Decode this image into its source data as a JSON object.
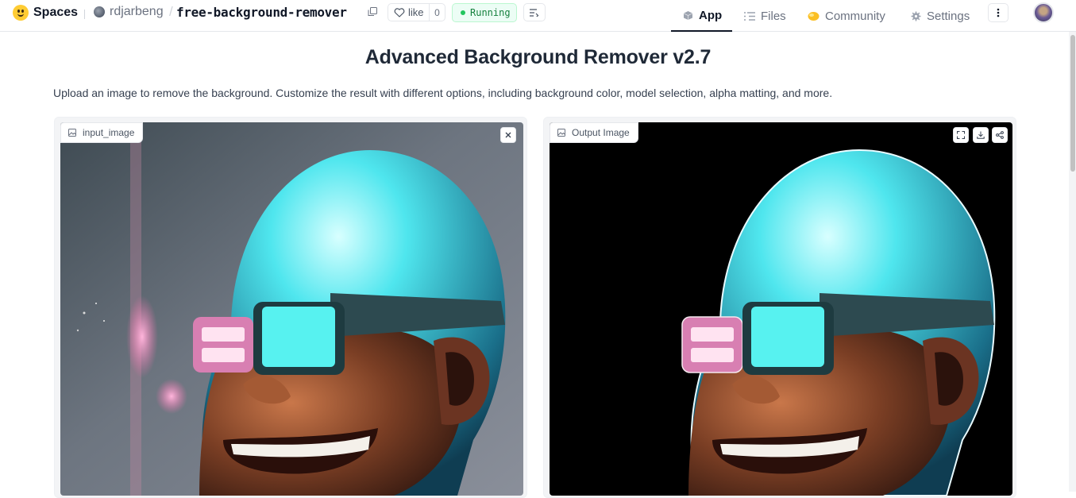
{
  "header": {
    "brand": "Spaces",
    "owner": "rdjarbeng",
    "separator": "/",
    "repo": "free-background-remover",
    "like_label": "like",
    "like_count": "0",
    "status": "Running"
  },
  "nav": {
    "tabs": [
      {
        "label": "App",
        "icon": "app-cube-icon",
        "active": true
      },
      {
        "label": "Files",
        "icon": "files-icon",
        "active": false
      },
      {
        "label": "Community",
        "icon": "community-icon",
        "active": false
      },
      {
        "label": "Settings",
        "icon": "gear-icon",
        "active": false
      }
    ]
  },
  "main": {
    "title": "Advanced Background Remover v2.7",
    "description": "Upload an image to remove the background. Customize the result with different options, including background color, model selection, alpha matting, and more.",
    "input_panel": {
      "label": "input_image",
      "clear_icon": "close-icon"
    },
    "output_panel": {
      "label": "Output Image",
      "tools": [
        "fullscreen-icon",
        "download-icon",
        "share-icon"
      ]
    }
  },
  "colors": {
    "running_green": "#22c55e",
    "skin_cyan": "#3ee6ee",
    "lens_pink": "#ff6fb0",
    "lens_cyan": "#57f2f0",
    "output_background": "#000000"
  }
}
